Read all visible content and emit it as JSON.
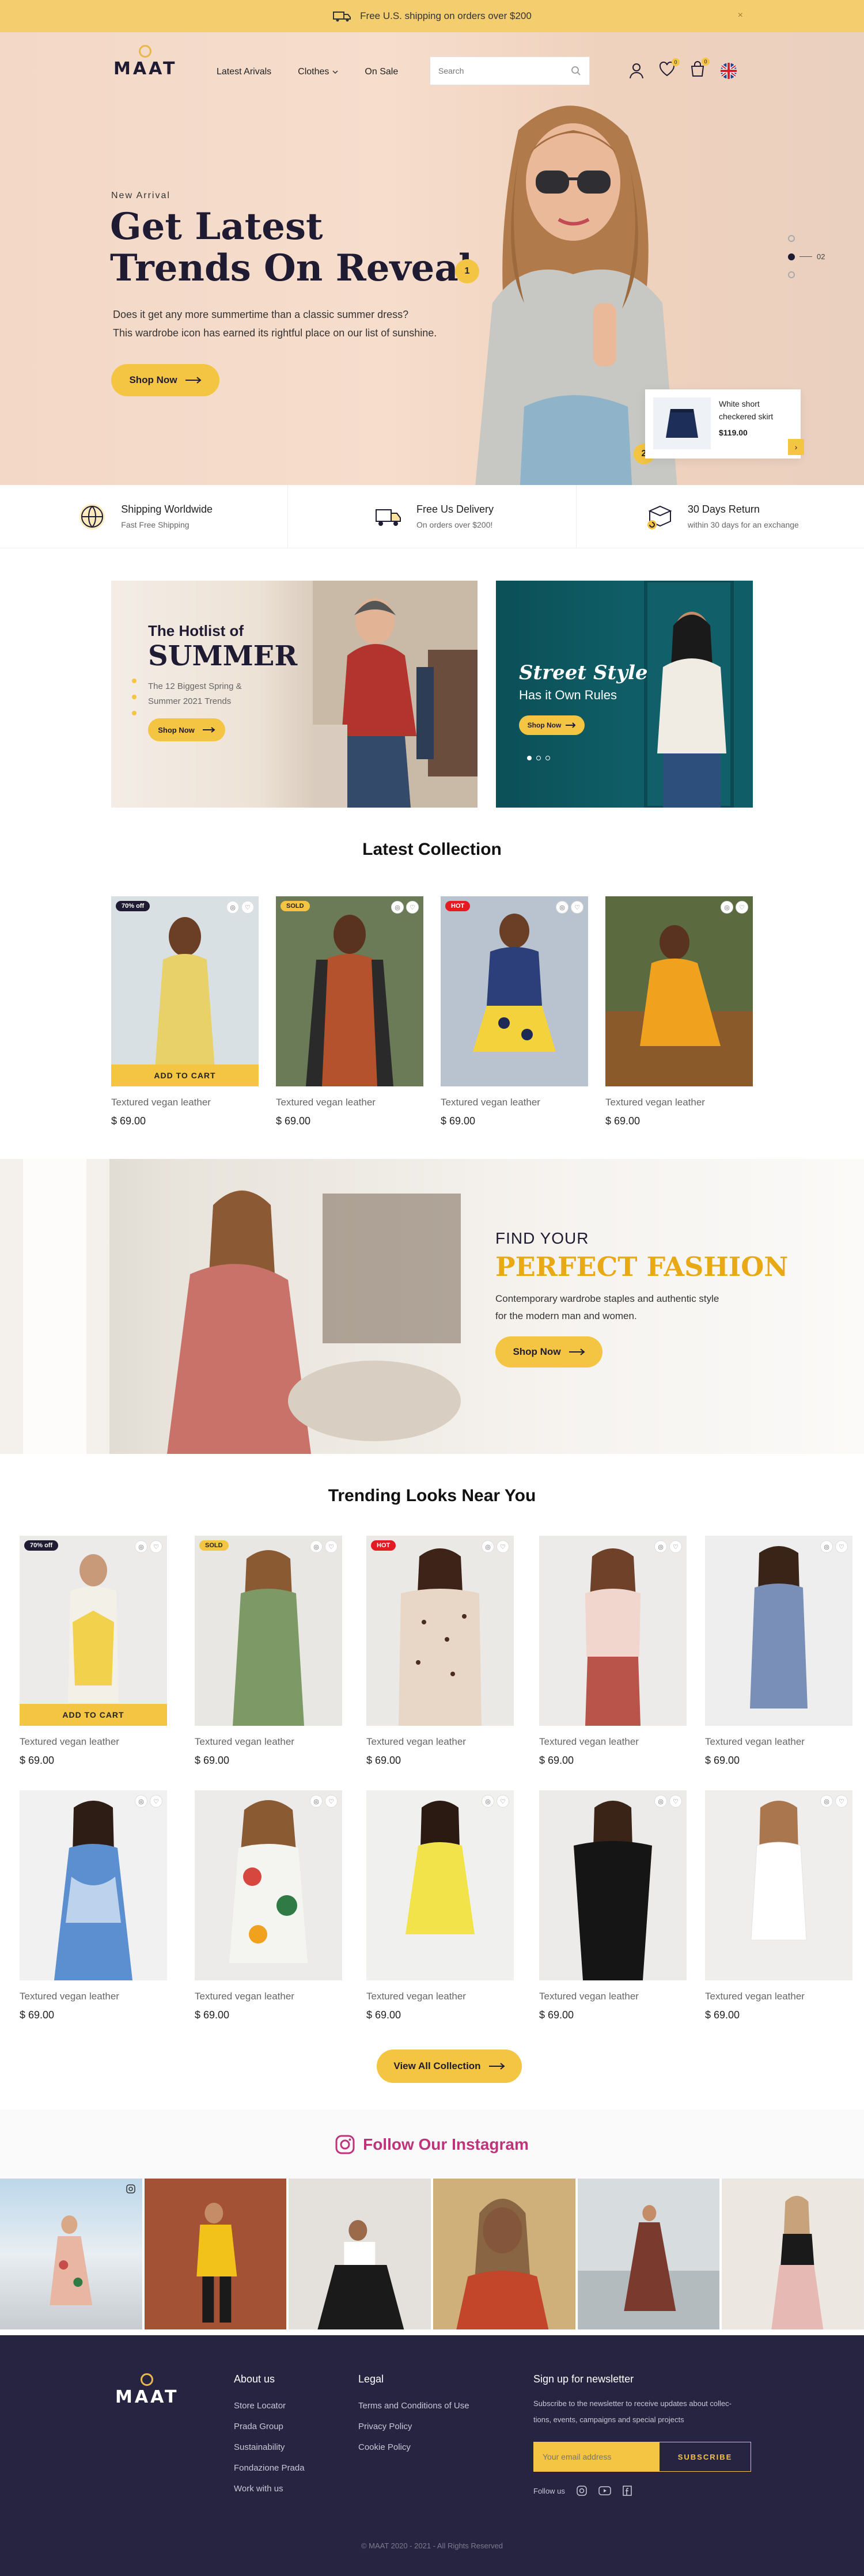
{
  "topbar": {
    "text": "Free U.S. shipping on orders over $200",
    "close": "×"
  },
  "header": {
    "logo": "MAAT",
    "nav": [
      "Latest Arivals",
      "Clothes",
      "On Sale"
    ],
    "search_placeholder": "Search",
    "cart_count": "0",
    "wishlist_count": "0"
  },
  "hero": {
    "kicker": "New Arrival",
    "title_line1": "Get Latest",
    "title_line2": "Trends On Reveal",
    "desc_line1": "Does it get any more summertime than a classic summer dress?",
    "desc_line2": "This wardrobe icon has earned its rightful place on our list of sunshine.",
    "cta": "Shop Now",
    "hotspot1": "1",
    "hotspot2": "2",
    "slide_current": "02",
    "product_name_line1": "White short",
    "product_name_line2": "checkered skirt",
    "product_price": "$119.00"
  },
  "features": [
    {
      "title": "Shipping Worldwide",
      "sub": "Fast Free Shipping"
    },
    {
      "title": "Free Us Delivery",
      "sub": "On orders over $200!"
    },
    {
      "title": "30 Days Return",
      "sub": "within 30 days for an exchange"
    }
  ],
  "banner1": {
    "line1": "The Hotlist of",
    "line2": "SUMMER",
    "sub1": "The 12 Biggest Spring &",
    "sub2": "Summer 2021 Trends",
    "cta": "Shop Now"
  },
  "banner2": {
    "line1": "Street Style",
    "line2": "Has it Own Rules",
    "cta": "Shop Now"
  },
  "latest": {
    "title": "Latest Collection",
    "items": [
      {
        "name": "Textured vegan leather",
        "price": "$ 69.00",
        "tag": "70% off",
        "cart": "ADD TO CART"
      },
      {
        "name": "Textured vegan leather",
        "price": "$ 69.00",
        "tag": "SOLD"
      },
      {
        "name": "Textured vegan leather",
        "price": "$ 69.00",
        "tag": "HOT"
      },
      {
        "name": "Textured vegan leather",
        "price": "$ 69.00"
      }
    ]
  },
  "fashion": {
    "line1": "FIND YOUR",
    "line2": "PERFECT FASHION",
    "desc1": "Contemporary wardrobe staples and authentic style",
    "desc2": "for the modern man and women.",
    "cta": "Shop Now"
  },
  "trending": {
    "title": "Trending Looks Near You",
    "items": [
      {
        "name": "Textured vegan leather",
        "price": "$ 69.00",
        "tag": "70% off",
        "cart": "ADD TO CART"
      },
      {
        "name": "Textured vegan leather",
        "price": "$ 69.00",
        "tag": "SOLD"
      },
      {
        "name": "Textured vegan leather",
        "price": "$ 69.00",
        "tag": "HOT"
      },
      {
        "name": "Textured vegan leather",
        "price": "$ 69.00"
      },
      {
        "name": "Textured vegan leather",
        "price": "$ 69.00"
      },
      {
        "name": "Textured vegan leather",
        "price": "$ 69.00"
      },
      {
        "name": "Textured vegan leather",
        "price": "$ 69.00"
      },
      {
        "name": "Textured vegan leather",
        "price": "$ 69.00"
      },
      {
        "name": "Textured vegan leather",
        "price": "$ 69.00"
      },
      {
        "name": "Textured vegan leather",
        "price": "$ 69.00"
      }
    ],
    "view_all": "View All Collection"
  },
  "instagram": {
    "title": "Follow Our Instagram"
  },
  "footer": {
    "logo": "MAAT",
    "about_title": "About us",
    "about_links": [
      "Store Locator",
      "Prada Group",
      "Sustainability",
      "Fondazione Prada",
      "Work with us"
    ],
    "legal_title": "Legal",
    "legal_links": [
      "Terms and Conditions of Use",
      "Privacy Policy",
      "Cookie Policy"
    ],
    "newsletter_title": "Sign up for newsletter",
    "newsletter_desc1": "Subscribe to the newsletter to receive updates about collec-",
    "newsletter_desc2": "tions, events, campaigns and special projects",
    "email_placeholder": "Your email address",
    "subscribe": "SUBSCRIBE",
    "follow": "Follow us",
    "copyright": "© MAAT 2020 - 2021 - All Rights Reserved"
  },
  "colors": {
    "accent": "#f4c542",
    "dark": "#1f1b33",
    "footer": "#262441",
    "teal": "#0f5d66",
    "hot": "#e31b23",
    "insta": "#c0337a"
  }
}
